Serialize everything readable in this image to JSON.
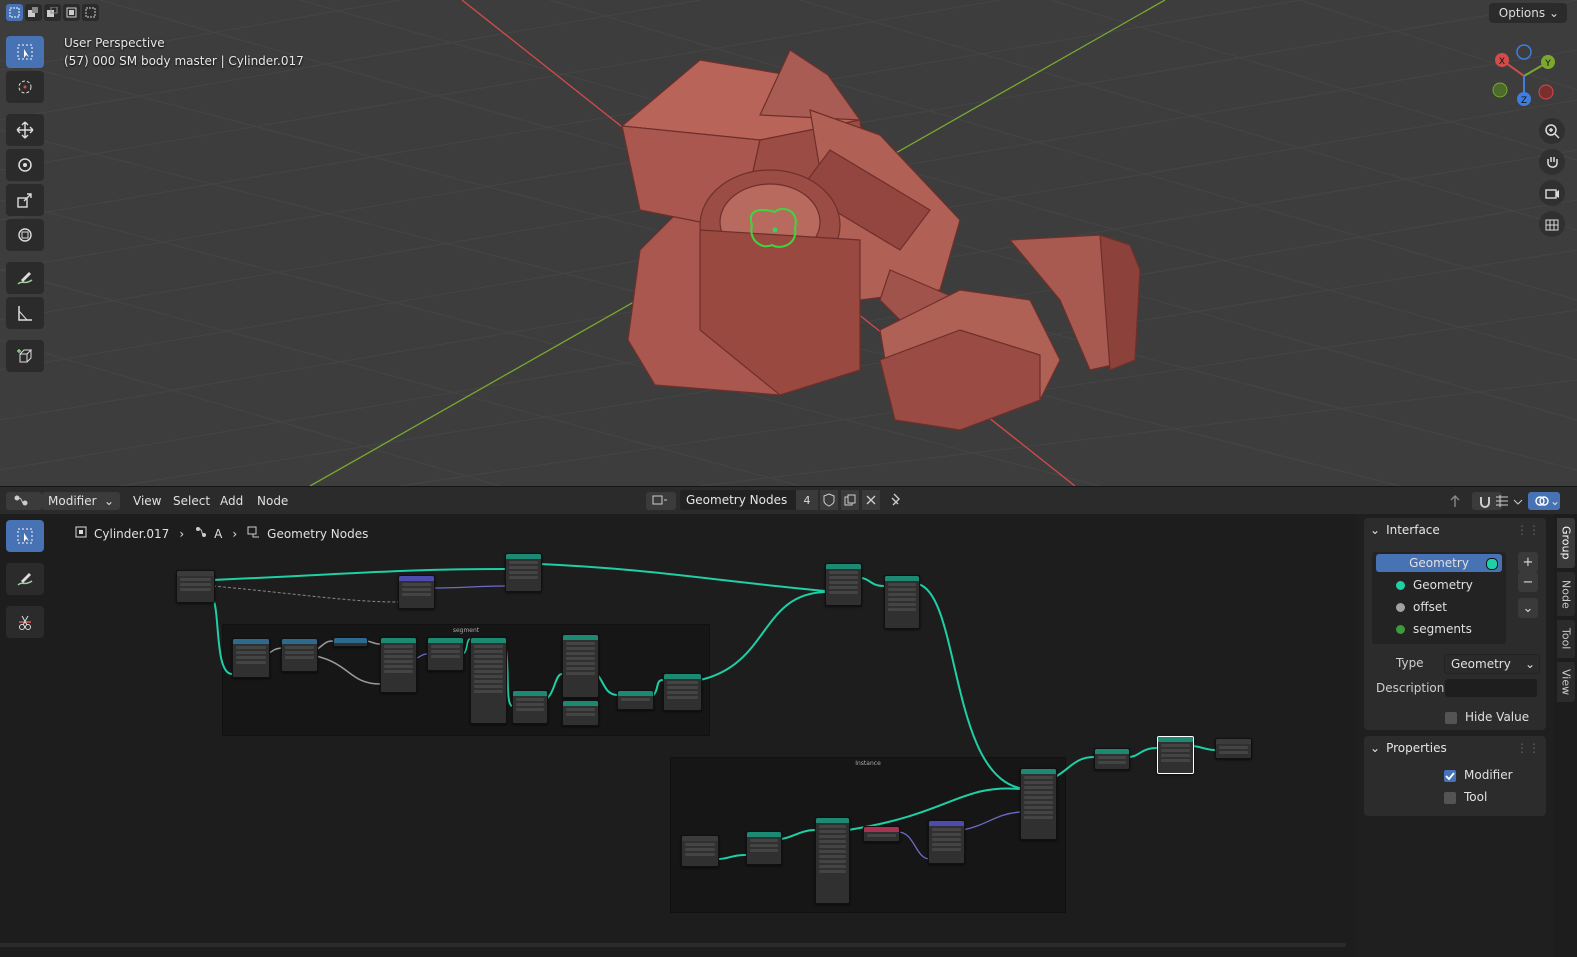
{
  "viewport": {
    "view_name": "User Perspective",
    "object_info": "(57) 000 SM body master | Cylinder.017",
    "options_label": "Options",
    "gizmo_axes": [
      "X",
      "Y",
      "Z"
    ],
    "tools": [
      "select-box-icon",
      "cursor-icon",
      "move-icon",
      "rotate-icon",
      "scale-icon",
      "transform-icon",
      "annotate-icon",
      "measure-icon",
      "add-cube-icon"
    ],
    "nav_buttons": [
      "zoom-icon",
      "hand-pan-icon",
      "camera-icon",
      "grid-ortho-icon"
    ],
    "colors": {
      "mesh": "#a9574f",
      "x_axis": "#d34b4b",
      "y_axis": "#7aa830",
      "origin": "#31d35c"
    }
  },
  "node_editor": {
    "editor_type": "Modifier",
    "menu": [
      "View",
      "Select",
      "Add",
      "Node"
    ],
    "node_tree_name": "Geometry Nodes",
    "user_count": "4",
    "breadcrumb": [
      "Cylinder.017",
      "A",
      "Geometry Nodes"
    ],
    "frames": [
      "segment",
      "Instance"
    ],
    "tools": [
      "select-icon",
      "annotate-icon",
      "cut-links-icon"
    ],
    "colors": {
      "link_geometry": "#1fcfa5",
      "link_vector": "#6c6cc7"
    }
  },
  "sidebar": {
    "interface_title": "Interface",
    "interface_items": [
      {
        "label": "Geometry",
        "color": "#1fcfa5",
        "active": true
      },
      {
        "label": "Geometry",
        "color": "#1fcfa5",
        "active": false
      },
      {
        "label": "offset",
        "color": "#a1a1a1",
        "active": false
      },
      {
        "label": "segments",
        "color": "#3c9b3c",
        "active": false
      }
    ],
    "type_label": "Type",
    "type_value": "Geometry",
    "description_label": "Description",
    "description_value": "",
    "hide_value_label": "Hide Value",
    "hide_value": false,
    "properties_title": "Properties",
    "modifier_label": "Modifier",
    "modifier": true,
    "tool_label": "Tool",
    "tool": false,
    "tabs": [
      "Group",
      "Node",
      "Tool",
      "View"
    ]
  }
}
